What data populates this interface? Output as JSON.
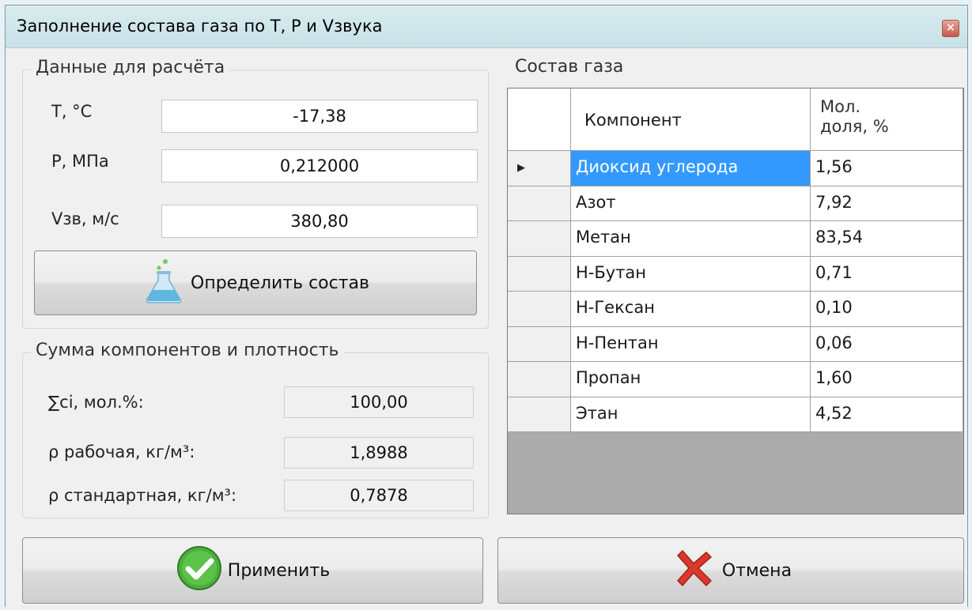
{
  "window": {
    "title": "Заполнение состава газа по T, P и Vзвука",
    "close_glyph": "×"
  },
  "input_group": {
    "title": "Данные для расчёта",
    "fields": [
      {
        "label": "T, °C",
        "value": "-17,38"
      },
      {
        "label": "P, МПа",
        "value": "0,212000"
      },
      {
        "label": "Vзв, м/с",
        "value": "380,80"
      }
    ],
    "determine_button": {
      "label": "Определить состав",
      "icon": "flask-icon"
    }
  },
  "sum_group": {
    "title": "Сумма компонентов и плотность",
    "rows": [
      {
        "label": "∑ci, мол.%:",
        "value": "100,00"
      },
      {
        "label": "ρ рабочая, кг/м³:",
        "value": "1,8988"
      },
      {
        "label": "ρ стандартная, кг/м³:",
        "value": "0,7878"
      }
    ]
  },
  "composition": {
    "title": "Состав газа",
    "columns": [
      "Компонент",
      "Мол.\nдоля, %"
    ],
    "rows": [
      {
        "component": "Диоксид углерода",
        "fraction": "1,56"
      },
      {
        "component": "Азот",
        "fraction": "7,92"
      },
      {
        "component": "Метан",
        "fraction": "83,54"
      },
      {
        "component": "Н-Бутан",
        "fraction": "0,71"
      },
      {
        "component": "Н-Гексан",
        "fraction": "0,10"
      },
      {
        "component": "Н-Пентан",
        "fraction": "0,06"
      },
      {
        "component": "Пропан",
        "fraction": "1,60"
      },
      {
        "component": "Этан",
        "fraction": "4,52"
      }
    ],
    "selected_row_marker": "▶"
  },
  "buttons": {
    "apply": {
      "label": "Применить",
      "icon": "check-icon"
    },
    "cancel": {
      "label": "Отмена",
      "icon": "x-icon"
    }
  },
  "colors": {
    "selection": "#3399ff",
    "grid_empty": "#ababab",
    "check": "#4caf3c",
    "cancel_x": "#d9382c"
  }
}
